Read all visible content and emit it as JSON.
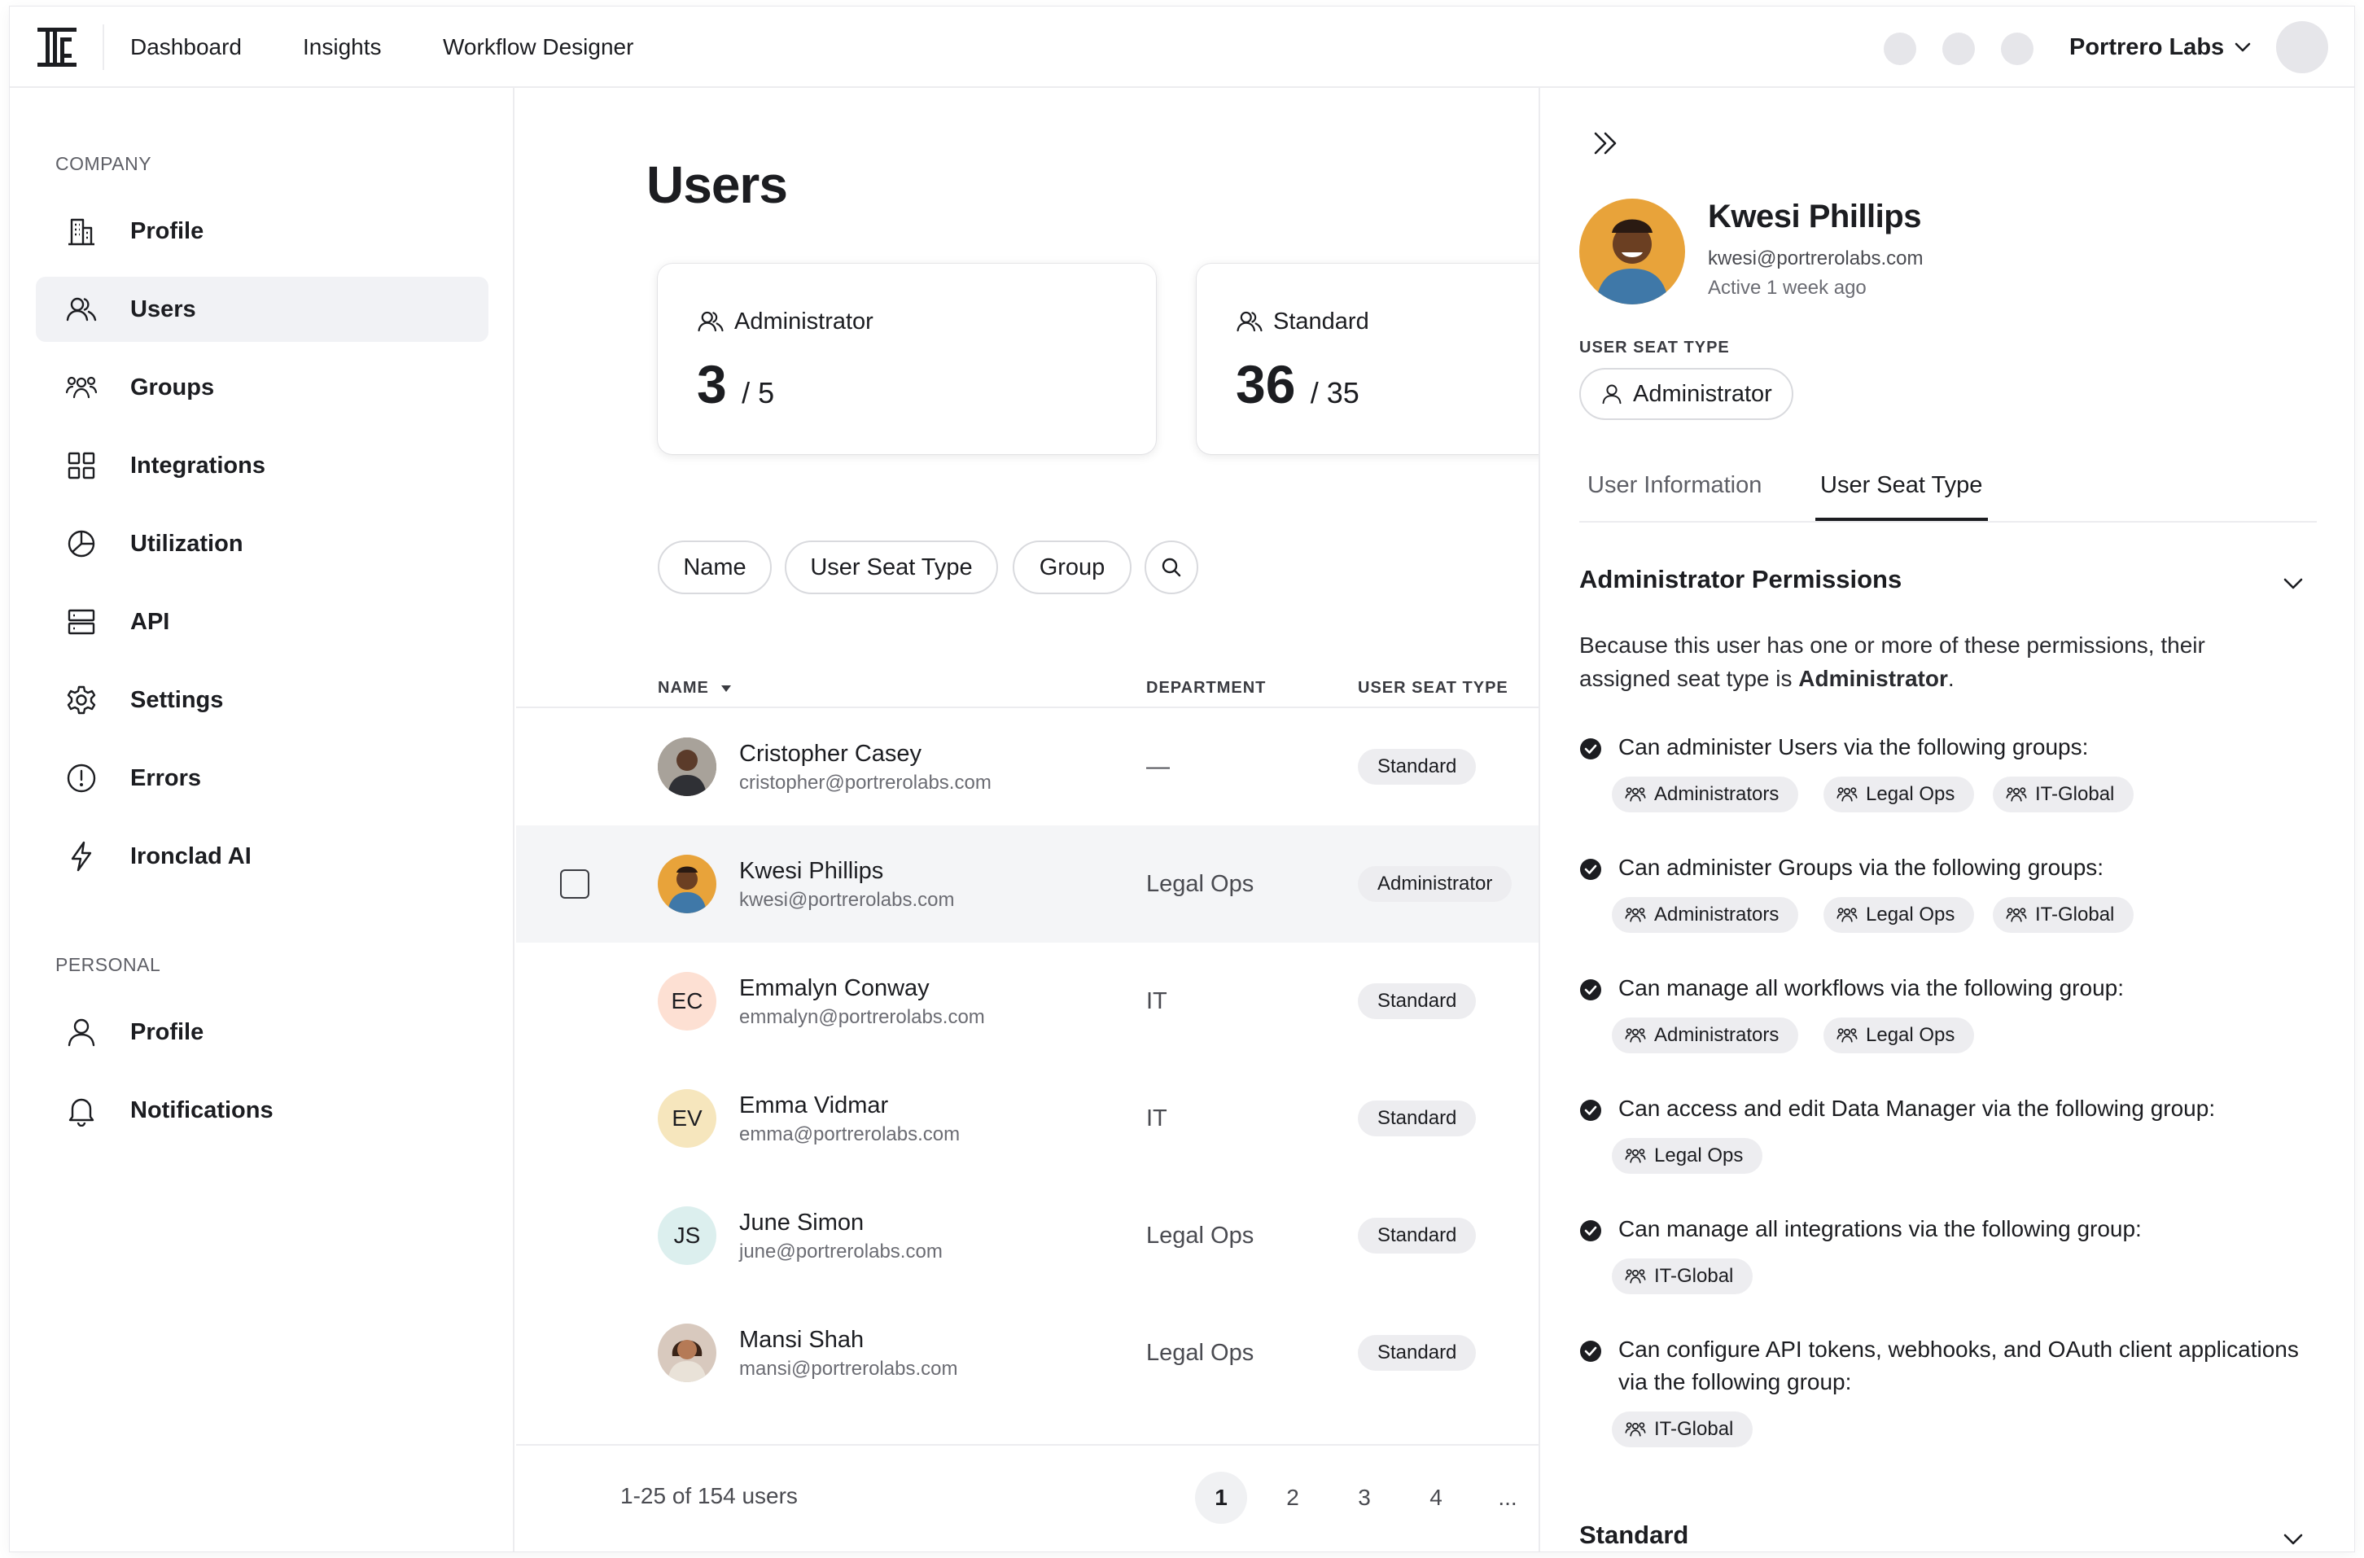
{
  "topbar": {
    "nav": [
      "Dashboard",
      "Insights",
      "Workflow Designer"
    ],
    "org_name": "Portrero Labs"
  },
  "sidebar": {
    "company_title": "COMPANY",
    "company_items": [
      {
        "label": "Profile",
        "icon": "building-icon"
      },
      {
        "label": "Users",
        "icon": "users-icon",
        "active": true
      },
      {
        "label": "Groups",
        "icon": "groups-icon"
      },
      {
        "label": "Integrations",
        "icon": "grid-icon"
      },
      {
        "label": "Utilization",
        "icon": "pie-chart-icon"
      },
      {
        "label": "API",
        "icon": "server-icon"
      },
      {
        "label": "Settings",
        "icon": "gear-icon"
      },
      {
        "label": "Errors",
        "icon": "alert-circle-icon"
      },
      {
        "label": "Ironclad AI",
        "icon": "lightning-icon"
      }
    ],
    "personal_title": "PERSONAL",
    "personal_items": [
      {
        "label": "Profile",
        "icon": "person-icon"
      },
      {
        "label": "Notifications",
        "icon": "bell-icon"
      }
    ]
  },
  "main": {
    "title": "Users",
    "stats": [
      {
        "label": "Administrator",
        "count": "3",
        "total": "/ 5"
      },
      {
        "label": "Standard",
        "count": "36",
        "total": "/ 35"
      }
    ],
    "filters": [
      "Name",
      "User Seat Type",
      "Group"
    ],
    "columns": [
      "NAME",
      "DEPARTMENT",
      "USER SEAT TYPE"
    ],
    "rows": [
      {
        "name": "Cristopher Casey",
        "email": "cristopher@portrerolabs.com",
        "department": "—",
        "seat": "Standard",
        "initials": ""
      },
      {
        "name": "Kwesi Phillips",
        "email": "kwesi@portrerolabs.com",
        "department": "Legal Ops",
        "seat": "Administrator",
        "initials": "",
        "selected": true
      },
      {
        "name": "Emmalyn Conway",
        "email": "emmalyn@portrerolabs.com",
        "department": "IT",
        "seat": "Standard",
        "initials": "EC"
      },
      {
        "name": "Emma Vidmar",
        "email": "emma@portrerolabs.com",
        "department": "IT",
        "seat": "Standard",
        "initials": "EV"
      },
      {
        "name": "June Simon",
        "email": "june@portrerolabs.com",
        "department": "Legal Ops",
        "seat": "Standard",
        "initials": "JS"
      },
      {
        "name": "Mansi Shah",
        "email": "mansi@portrerolabs.com",
        "department": "Legal Ops",
        "seat": "Standard",
        "initials": ""
      }
    ],
    "pagination": {
      "summary": "1-25 of 154 users",
      "pages": [
        "1",
        "2",
        "3",
        "4",
        "..."
      ],
      "current": "1"
    }
  },
  "panel": {
    "name": "Kwesi Phillips",
    "email": "kwesi@portrerolabs.com",
    "active": "Active 1 week ago",
    "seat_label": "USER SEAT TYPE",
    "seat_value": "Administrator",
    "tabs": [
      "User Information",
      "User Seat Type"
    ],
    "active_tab": "User Seat Type",
    "section_title": "Administrator Permissions",
    "desc_prefix": "Because this user has one or more of these permissions, their assigned seat type is ",
    "desc_bold": "Administrator",
    "desc_suffix": ".",
    "permissions": [
      {
        "text": "Can administer Users via the following groups:",
        "groups": [
          "Administrators",
          "Legal Ops",
          "IT-Global"
        ]
      },
      {
        "text": "Can administer Groups via the following groups:",
        "groups": [
          "Administrators",
          "Legal Ops",
          "IT-Global"
        ]
      },
      {
        "text": "Can manage all workflows via the following group:",
        "groups": [
          "Administrators",
          "Legal Ops"
        ]
      },
      {
        "text": "Can access and edit Data Manager via the following group:",
        "groups": [
          "Legal Ops"
        ]
      },
      {
        "text": "Can manage all integrations via the following group:",
        "groups": [
          "IT-Global"
        ]
      },
      {
        "text": "Can configure API tokens, webhooks, and OAuth client applications via the following group:",
        "groups": [
          "IT-Global"
        ]
      }
    ],
    "next_section": "Standard"
  },
  "colors": {
    "text": "#1c1d21",
    "muted": "#6b6c73",
    "chip_bg": "#ededf0",
    "active_bg": "#f1f2f5",
    "avatar_ec": "#fde0d3",
    "avatar_ev": "#f6e6bd",
    "avatar_js": "#dcefee"
  }
}
